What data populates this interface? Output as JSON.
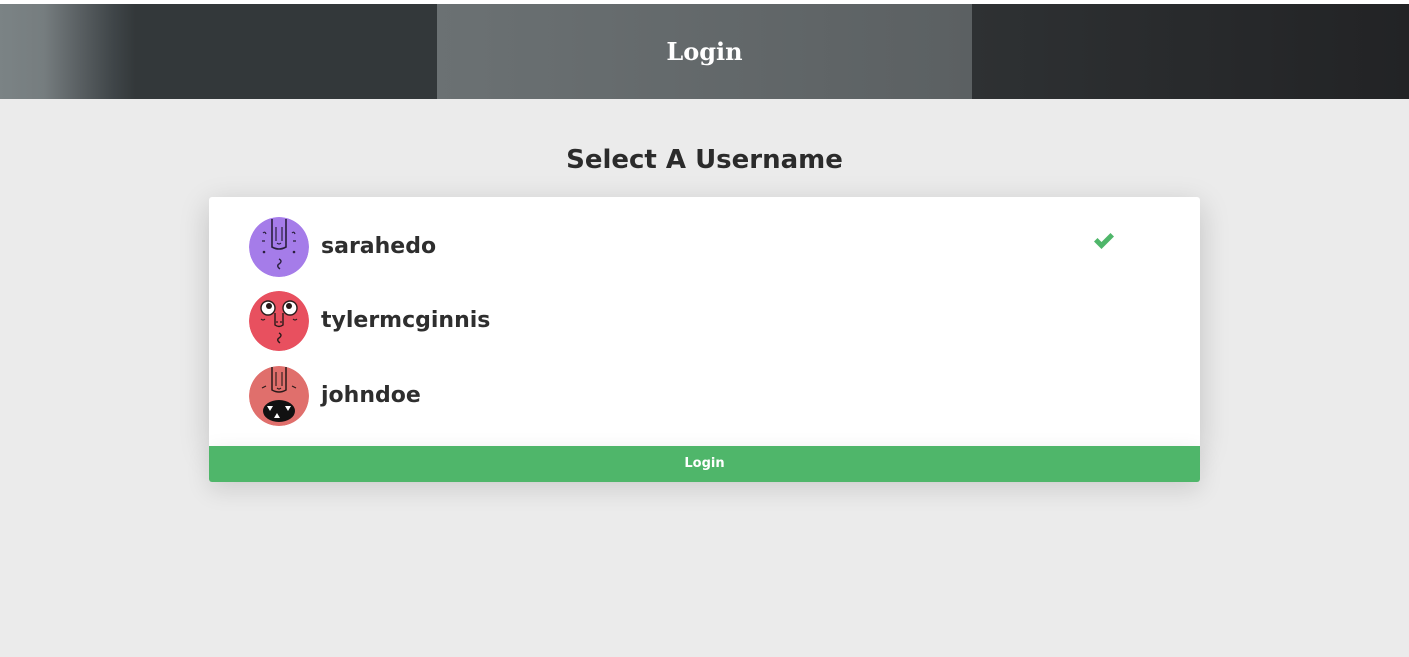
{
  "header": {
    "title": "Login"
  },
  "heading": "Select A Username",
  "users": [
    {
      "username": "sarahedo",
      "avatar_color": "#a57ce9",
      "selected": true
    },
    {
      "username": "tylermcginnis",
      "avatar_color": "#e8505f",
      "selected": false
    },
    {
      "username": "johndoe",
      "avatar_color": "#e06f6c",
      "selected": false
    }
  ],
  "selected_icon": "check-icon",
  "colors": {
    "accent": "#4fb66a",
    "background": "#ebebeb",
    "header_center": "#5e6366"
  },
  "login_button": {
    "label": "Login"
  }
}
